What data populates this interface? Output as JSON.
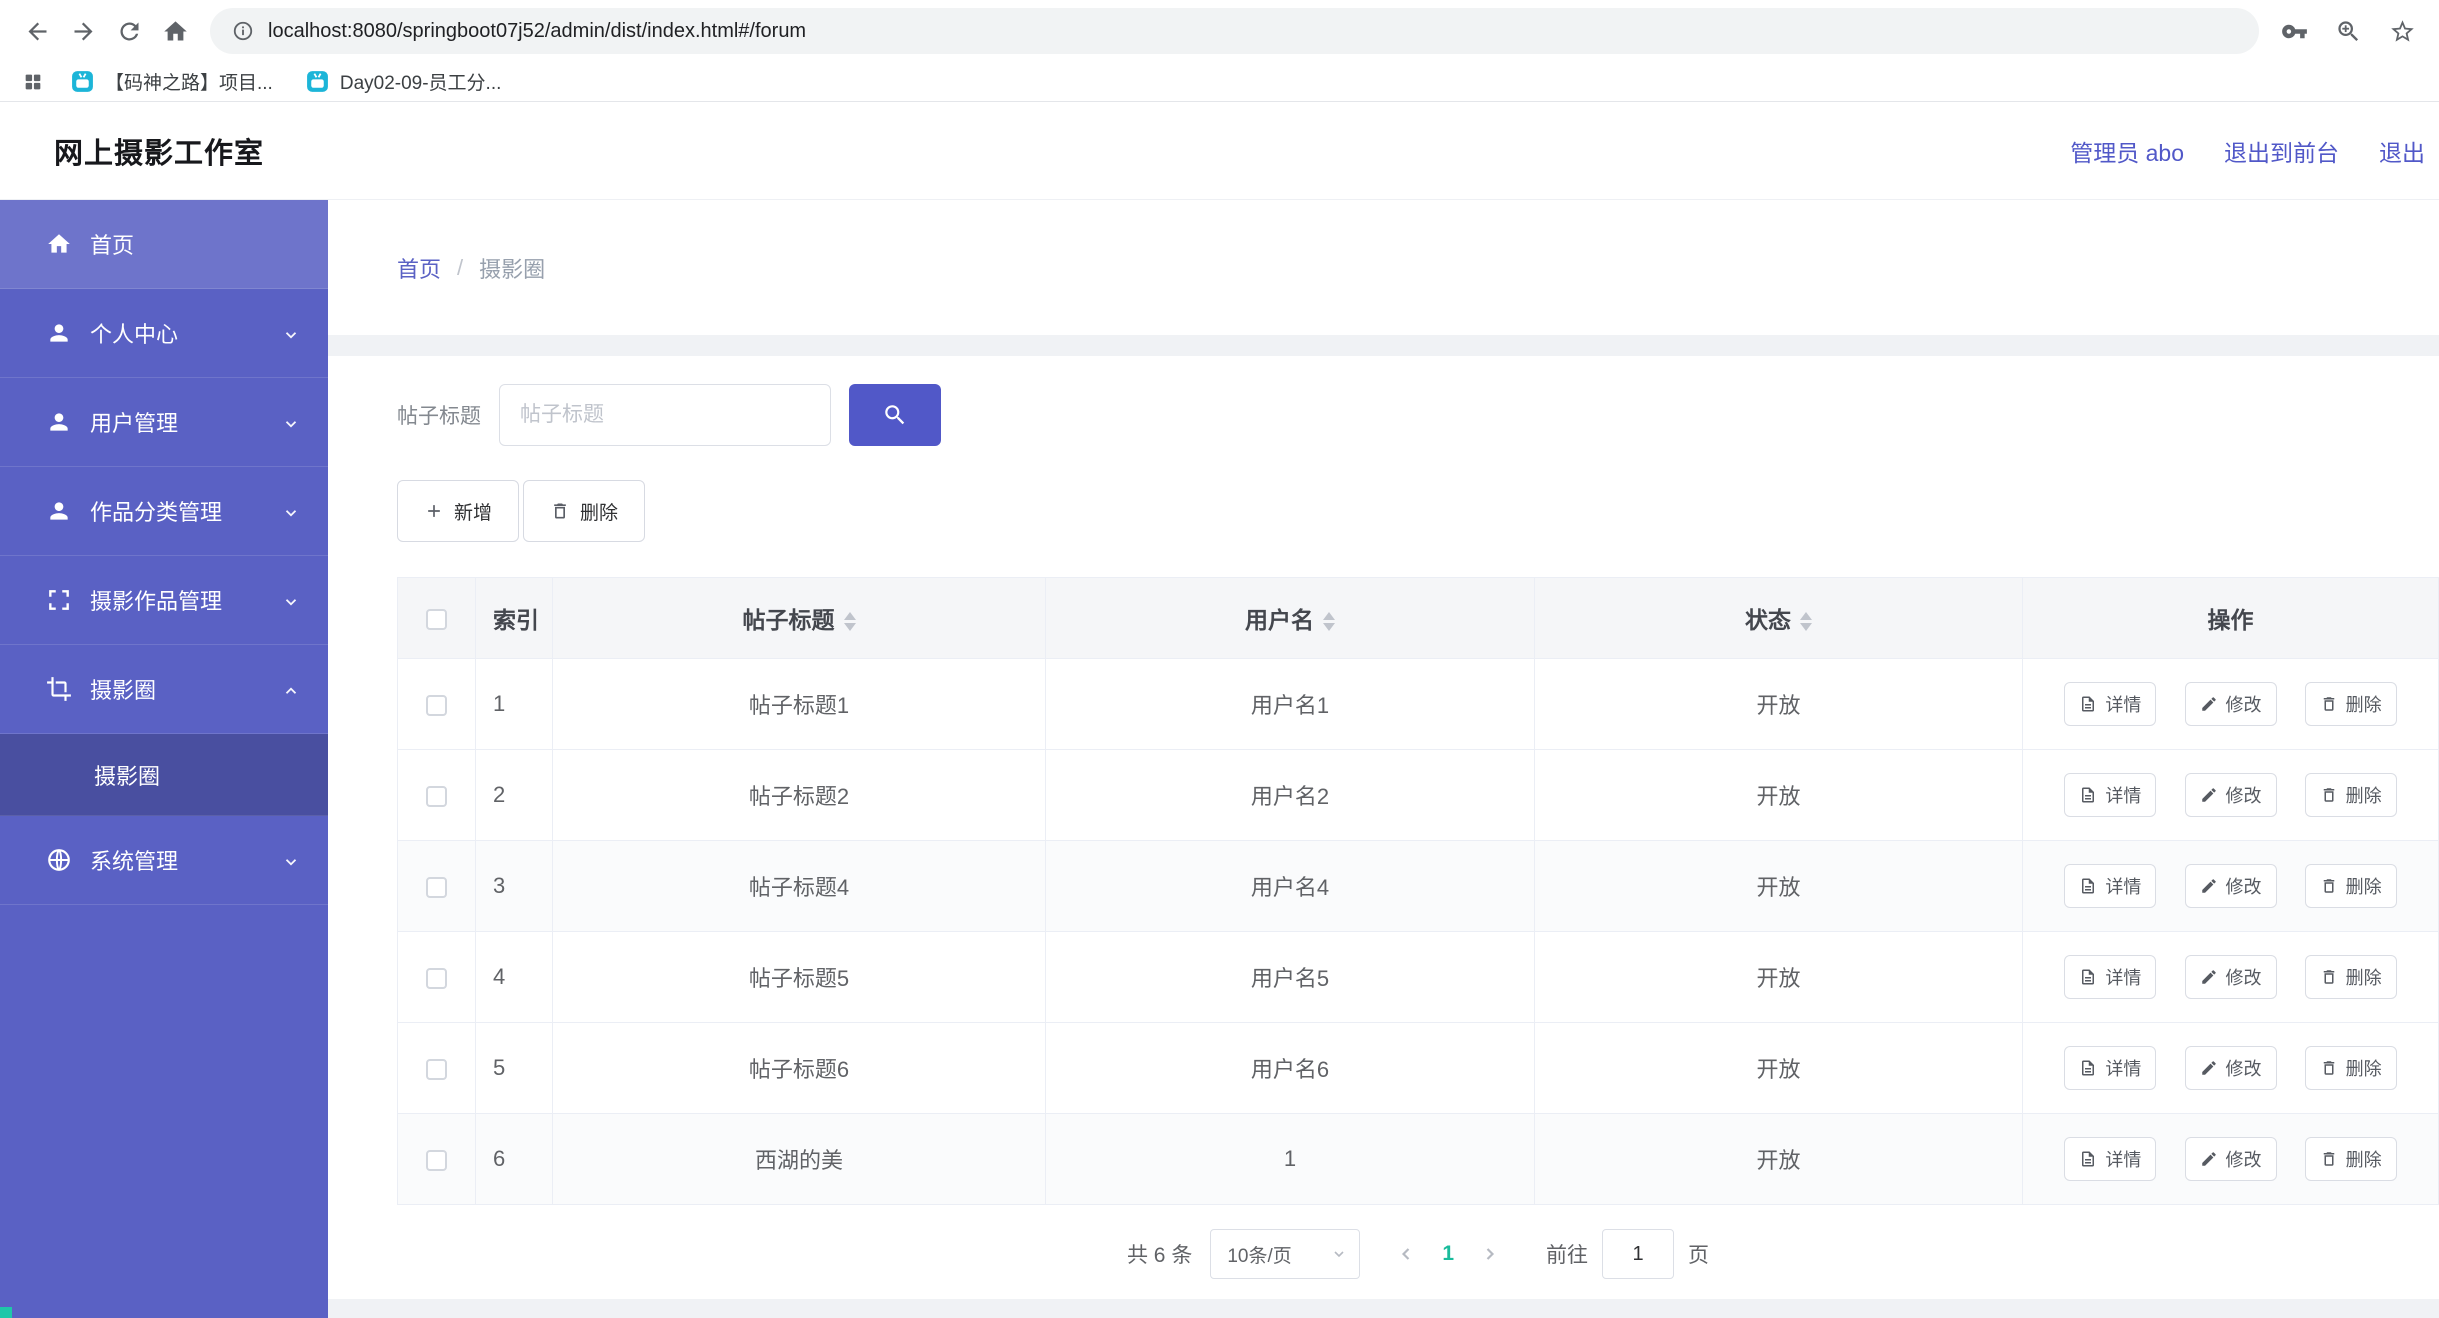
{
  "colors": {
    "sidebar": "#5a61c4",
    "accent": "#5158c8",
    "teal": "#1abc9c"
  },
  "browser": {
    "url": "localhost:8080/springboot07j52/admin/dist/index.html#/forum",
    "bookmarks": [
      {
        "label": "【码神之路】项目...",
        "icon": "video-site-icon"
      },
      {
        "label": "Day02-09-员工分...",
        "icon": "video-site-icon"
      }
    ]
  },
  "header": {
    "title": "网上摄影工作室",
    "links": [
      {
        "label": "管理员 abo"
      },
      {
        "label": "退出到前台"
      },
      {
        "label": "退出"
      }
    ]
  },
  "sidebar": {
    "items": [
      {
        "label": "首页",
        "icon": "home-icon"
      },
      {
        "label": "个人中心",
        "icon": "user-icon"
      },
      {
        "label": "用户管理",
        "icon": "user-icon"
      },
      {
        "label": "作品分类管理",
        "icon": "user-icon"
      },
      {
        "label": "摄影作品管理",
        "icon": "frame-icon"
      },
      {
        "label": "摄影圈",
        "icon": "crop-icon"
      },
      {
        "label": "系统管理",
        "icon": "globe-icon"
      }
    ],
    "submenu": {
      "label": "摄影圈"
    }
  },
  "breadcrumb": {
    "home": "首页",
    "separator": "/",
    "current": "摄影圈"
  },
  "search": {
    "label": "帖子标题",
    "placeholder": "帖子标题"
  },
  "toolbar": {
    "add": "新增",
    "delete": "删除"
  },
  "table": {
    "columns": {
      "index": "索引",
      "title": "帖子标题",
      "username": "用户名",
      "status": "状态",
      "actions": "操作"
    },
    "rows": [
      {
        "index": "1",
        "title": "帖子标题1",
        "username": "用户名1",
        "status": "开放"
      },
      {
        "index": "2",
        "title": "帖子标题2",
        "username": "用户名2",
        "status": "开放"
      },
      {
        "index": "3",
        "title": "帖子标题4",
        "username": "用户名4",
        "status": "开放"
      },
      {
        "index": "4",
        "title": "帖子标题5",
        "username": "用户名5",
        "status": "开放"
      },
      {
        "index": "5",
        "title": "帖子标题6",
        "username": "用户名6",
        "status": "开放"
      },
      {
        "index": "6",
        "title": "西湖的美",
        "username": "1",
        "status": "开放"
      }
    ],
    "actions": {
      "detail": "详情",
      "edit": "修改",
      "delete": "删除"
    }
  },
  "pagination": {
    "total": "共 6 条",
    "page_size": "10条/页",
    "current_page": "1",
    "goto_label": "前往",
    "goto_value": "1",
    "page_label": "页"
  }
}
